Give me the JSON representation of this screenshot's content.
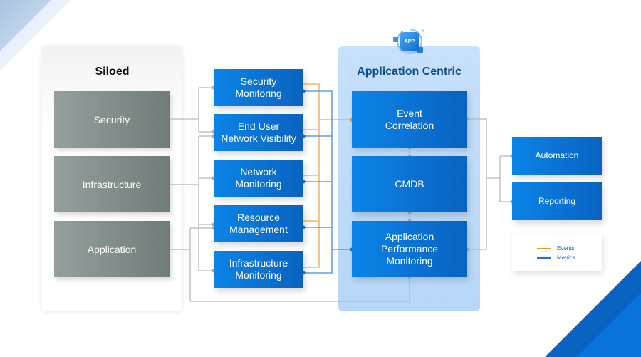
{
  "siloed": {
    "title": "Siloed",
    "items": [
      "Security",
      "Infrastructure",
      "Application"
    ]
  },
  "monitoring": {
    "items": [
      [
        "Security",
        "Monitoring"
      ],
      [
        "End User",
        "Network Visibility"
      ],
      [
        "Network",
        "Monitoring"
      ],
      [
        "Resource",
        "Management"
      ],
      [
        "Infrastructure",
        "Monitoring"
      ]
    ]
  },
  "application_centric": {
    "title": "Application Centric",
    "icon_label": "APP",
    "items": [
      [
        "Event",
        "Correlation"
      ],
      [
        "CMDB"
      ],
      [
        "Application",
        "Performance",
        "Monitoring"
      ]
    ]
  },
  "outputs": {
    "items": [
      "Automation",
      "Reporting"
    ]
  },
  "legend": {
    "items": [
      {
        "label": "Events",
        "color": "#f7931e"
      },
      {
        "label": "Metrics",
        "color": "#1a73d9"
      }
    ]
  },
  "colors": {
    "events": "#f7931e",
    "metrics": "#1a73d9",
    "neutral_line": "#b5b9bb",
    "blue_box": "#0a74db",
    "gray_box": "#828d8b"
  }
}
